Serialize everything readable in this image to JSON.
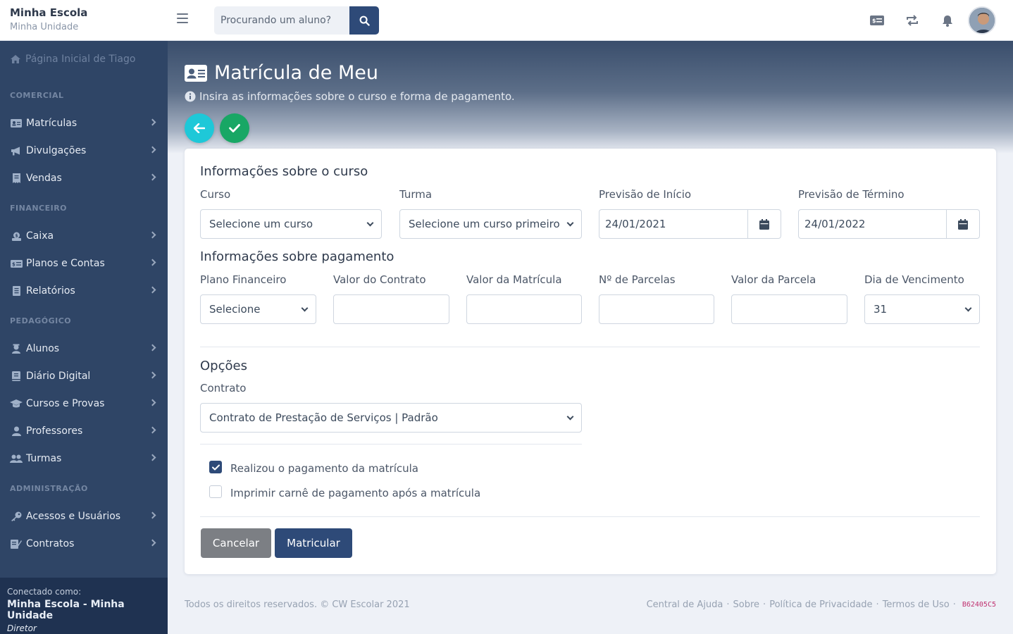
{
  "brand": {
    "title": "Minha Escola",
    "subtitle": "Minha Unidade"
  },
  "search": {
    "placeholder": "Procurando um aluno?"
  },
  "sidebar": {
    "home": "Página Inicial de Tiago",
    "sections": {
      "comercial": "COMERCIAL",
      "financeiro": "FINANCEIRO",
      "pedagogico": "PEDAGÓGICO",
      "administracao": "ADMINISTRAÇÃO"
    },
    "items": {
      "matriculas": "Matrículas",
      "divulgacoes": "Divulgações",
      "vendas": "Vendas",
      "caixa": "Caixa",
      "planos": "Planos e Contas",
      "relatorios": "Relatórios",
      "alunos": "Alunos",
      "diario": "Diário Digital",
      "cursos": "Cursos e Provas",
      "professores": "Professores",
      "turmas": "Turmas",
      "acessos": "Acessos e Usuários",
      "contratos": "Contratos"
    },
    "footer": {
      "connected_label": "Conectado como:",
      "user": "Minha Escola - Minha Unidade",
      "role": "Diretor"
    }
  },
  "page": {
    "title": "Matrícula de Meu",
    "subtitle": "Insira as informações sobre o curso e forma de pagamento."
  },
  "course": {
    "heading": "Informações sobre o curso",
    "curso_label": "Curso",
    "curso_value": "Selecione um curso",
    "turma_label": "Turma",
    "turma_value": "Selecione um curso primeiro",
    "inicio_label": "Previsão de Início",
    "inicio_value": "24/01/2021",
    "termino_label": "Previsão de Término",
    "termino_value": "24/01/2022"
  },
  "payment": {
    "heading": "Informações sobre pagamento",
    "plano_label": "Plano Financeiro",
    "plano_value": "Selecione",
    "valor_contrato_label": "Valor do Contrato",
    "valor_contrato_value": "",
    "valor_matricula_label": "Valor da Matrícula",
    "valor_matricula_value": "",
    "parcelas_label": "Nº de Parcelas",
    "parcelas_value": "",
    "valor_parcela_label": "Valor da Parcela",
    "valor_parcela_value": "",
    "vencimento_label": "Dia de Vencimento",
    "vencimento_value": "31"
  },
  "options": {
    "heading": "Opções",
    "contrato_label": "Contrato",
    "contrato_value": "Contrato de Prestação de Serviços | Padrão",
    "check_pagamento": "Realizou o pagamento da matrícula",
    "check_pagamento_checked": true,
    "check_carne": "Imprimir carnê de pagamento após a matrícula",
    "check_carne_checked": false
  },
  "actions": {
    "cancel": "Cancelar",
    "submit": "Matricular"
  },
  "footer": {
    "copyright": "Todos os direitos reservados. © CW Escolar 2021",
    "links": [
      "Central de Ajuda",
      "Sobre",
      "Política de Privacidade",
      "Termos de Uso"
    ],
    "separator": "·",
    "build": "B62405C5"
  },
  "colors": {
    "primary": "#2e4a78",
    "sidebar": "#2f4566",
    "back_button": "#1ec8d8",
    "confirm_button": "#18a765",
    "cancel_button": "#7c7f84"
  },
  "icons": [
    "menu-icon",
    "search-icon",
    "billing-icon",
    "sync-icon",
    "bell-icon",
    "id-card-icon",
    "info-icon",
    "arrow-left-icon",
    "check-icon",
    "calendar-icon",
    "chevron-right-icon"
  ]
}
